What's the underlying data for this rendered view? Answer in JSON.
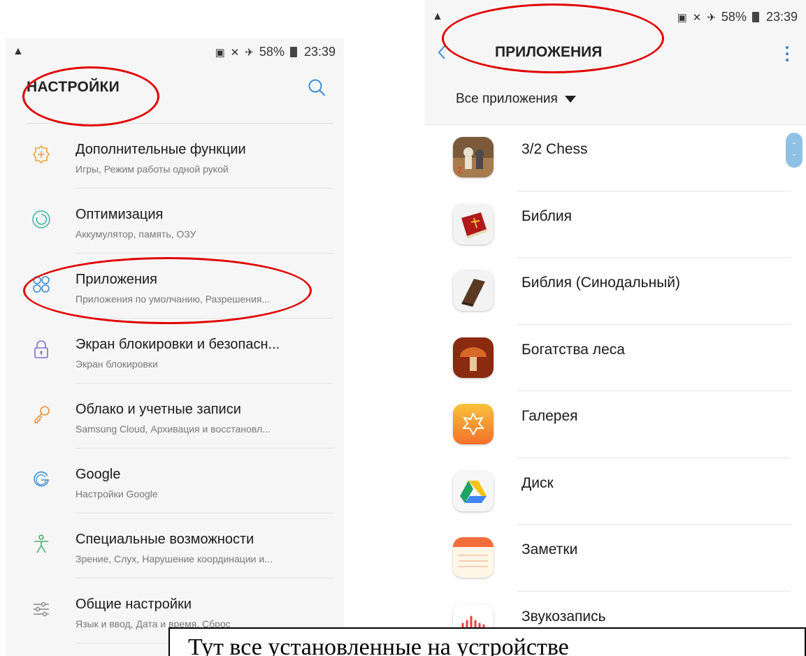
{
  "left_screen": {
    "status": {
      "battery": "58%",
      "time": "23:39"
    },
    "title": "НАСТРОЙКИ",
    "items": [
      {
        "icon": "plus-gear-icon",
        "title": "Дополнительные функции",
        "subtitle": "Игры, Режим работы одной рукой"
      },
      {
        "icon": "optimization-icon",
        "title": "Оптимизация",
        "subtitle": "Аккумулятор, память, ОЗУ"
      },
      {
        "icon": "apps-icon",
        "title": "Приложения",
        "subtitle": "Приложения по умолчанию, Разрешения..."
      },
      {
        "icon": "lock-icon",
        "title": "Экран блокировки и безопасн...",
        "subtitle": "Экран блокировки"
      },
      {
        "icon": "key-icon",
        "title": "Облако и учетные записи",
        "subtitle": "Samsung Cloud, Архивация и восстановл..."
      },
      {
        "icon": "google-icon",
        "title": "Google",
        "subtitle": "Настройки Google"
      },
      {
        "icon": "accessibility-icon",
        "title": "Специальные возможности",
        "subtitle": "Зрение, Слух, Нарушение координации и..."
      },
      {
        "icon": "sliders-icon",
        "title": "Общие настройки",
        "subtitle": "Язык и ввод, Дата и время, Сброс"
      }
    ]
  },
  "right_screen": {
    "status": {
      "battery": "58%",
      "time": "23:39"
    },
    "title": "ПРИЛОЖЕНИЯ",
    "filter": "Все приложения",
    "apps": [
      {
        "icon": "chess-icon",
        "name": "3/2 Chess"
      },
      {
        "icon": "bible-red-icon",
        "name": "Библия"
      },
      {
        "icon": "bible-brown-icon",
        "name": "Библия (Синодальный)"
      },
      {
        "icon": "mushroom-icon",
        "name": "Богатства леса"
      },
      {
        "icon": "gallery-icon",
        "name": "Галерея"
      },
      {
        "icon": "drive-icon",
        "name": "Диск"
      },
      {
        "icon": "notes-icon",
        "name": "Заметки"
      },
      {
        "icon": "voice-recorder-icon",
        "name": "Звукозапись"
      }
    ]
  },
  "callout": "Тут все установленные на устройстве"
}
